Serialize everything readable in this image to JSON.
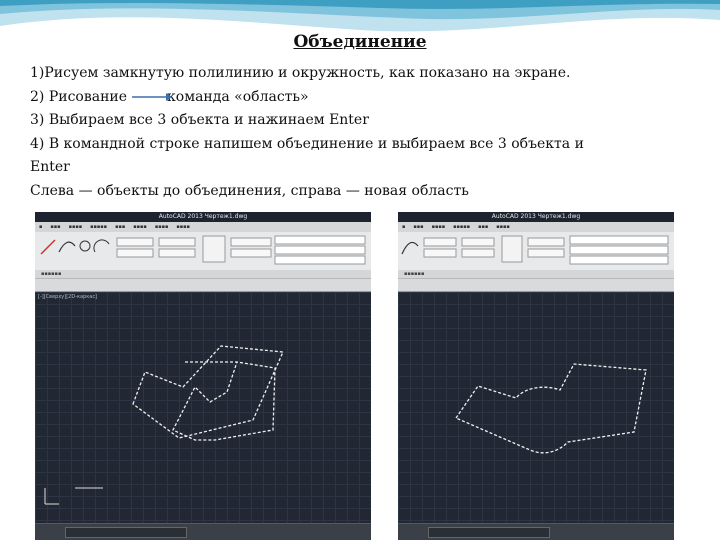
{
  "slide": {
    "title": "Объединение",
    "lines": [
      "1)Рисуем замкнутую полилинию и окружность, как показано на экране.",
      "3) Выбираем все 3 объекта и нажинаем Enter",
      "4) В командной строке напишем объединение и выбираем все 3 объекта и",
      "Enter",
      "Слева — объекты до объединения, справа — новая область"
    ],
    "line2_left": "2) Рисование",
    "line2_right": "команда «область»"
  },
  "screenshots": {
    "left": {
      "window_title": "AutoCAD 2013   Чертеж1.dwg",
      "viewport_label": "[-][Сверху][2D-каркас]"
    },
    "right": {
      "window_title": "AutoCAD 2013   Чертеж1.dwg"
    }
  },
  "colors": {
    "canvas_bg": "#212834",
    "ribbon_bg": "#e8e9ea",
    "accent_wave": "#7fc4dc",
    "drawing_line": "#f0f0f0"
  }
}
